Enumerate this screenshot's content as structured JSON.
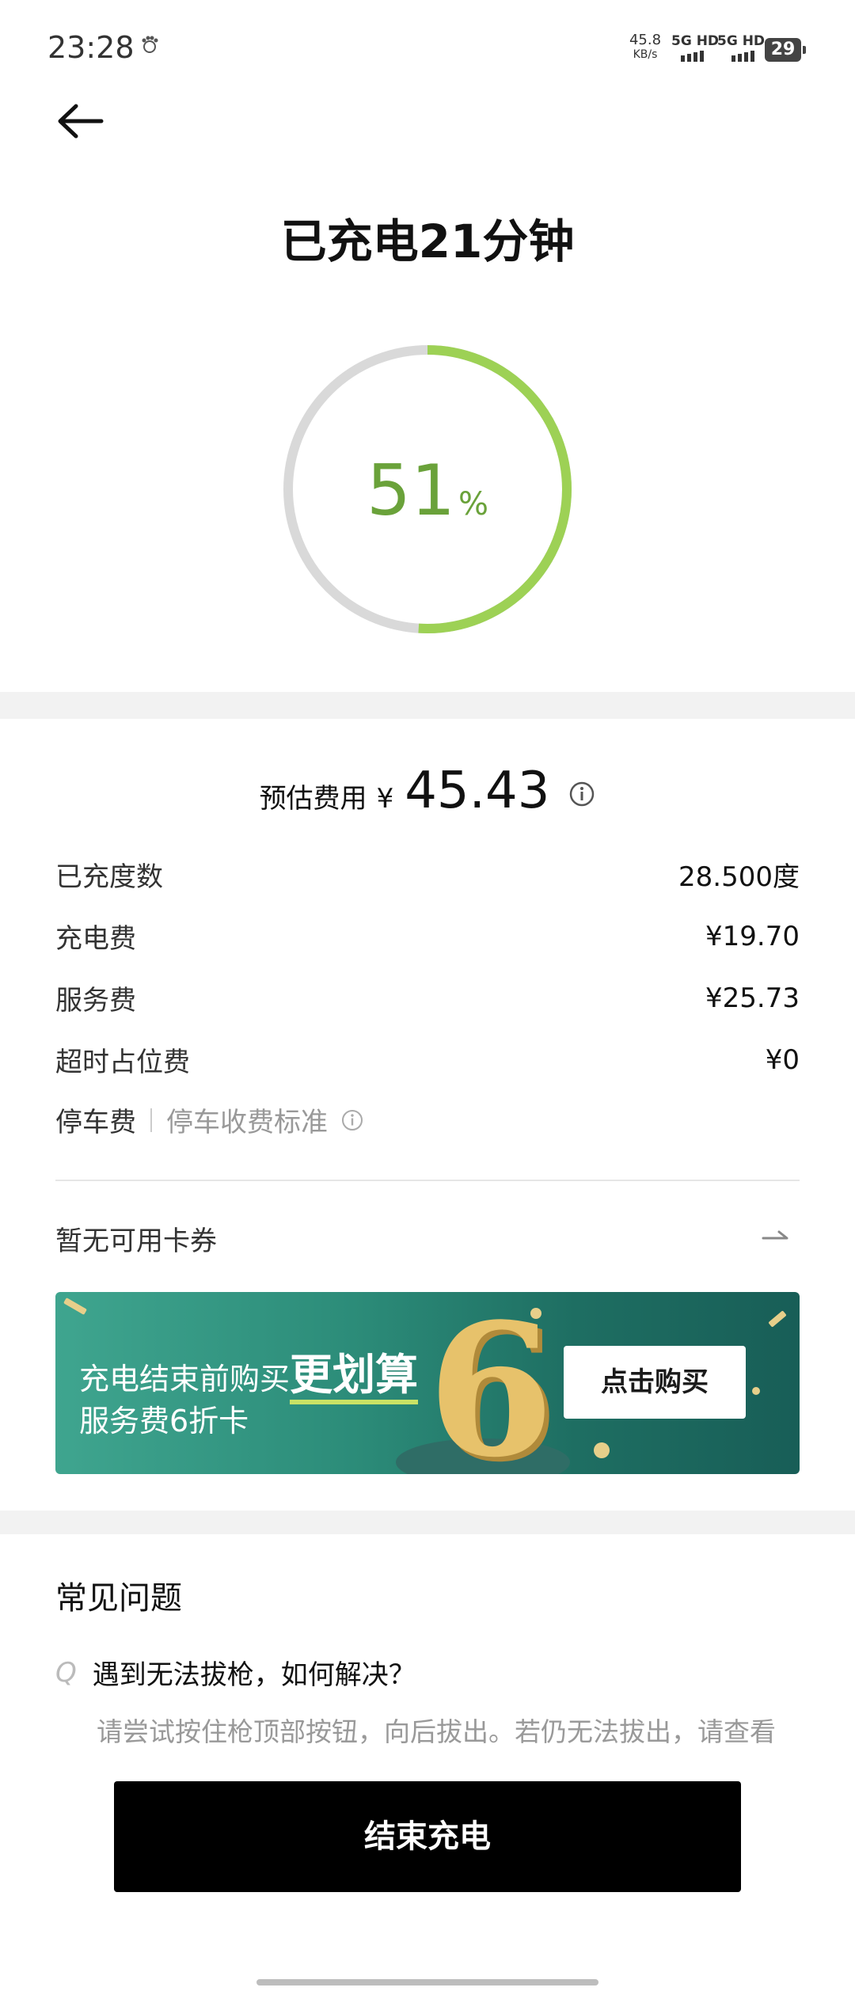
{
  "status_bar": {
    "time": "23:28",
    "net_speed_value": "45.8",
    "net_speed_unit": "KB/s",
    "sim1": "5G HD",
    "sim2": "5G HD",
    "battery": "29",
    "notification_icon": "paw-icon"
  },
  "header": {
    "back_icon": "arrow-left-icon",
    "title": "已充电21分钟"
  },
  "progress": {
    "percent_value": "51",
    "percent_unit": "%",
    "fraction": 0.51,
    "ring_color": "#9dd155",
    "track_color": "#d9d9d9",
    "text_color": "#6aa23a"
  },
  "estimate": {
    "label": "预估费用",
    "currency": "¥",
    "amount": "45.43",
    "info_icon": "info-icon"
  },
  "fees": [
    {
      "label": "已充度数",
      "value": "28.500度"
    },
    {
      "label": "充电费",
      "value": "¥19.70"
    },
    {
      "label": "服务费",
      "value": "¥25.73"
    },
    {
      "label": "超时占位费",
      "value": "¥0"
    }
  ],
  "parking": {
    "label": "停车费",
    "standard_link": "停车收费标准"
  },
  "coupon": {
    "text": "暂无可用卡券",
    "arrow_icon": "arrow-right-icon"
  },
  "banner": {
    "line1_prefix": "充电结束前购买",
    "line1_highlight": "更划算",
    "line2": "服务费6折卡",
    "big_number": "6",
    "button": "点击购买"
  },
  "faq": {
    "title": "常见问题",
    "q_marker": "Q",
    "question": "遇到无法拔枪，如何解决？",
    "answer": "请尝试按住枪顶部按钮，向后拔出。若仍无法拔出，请查看"
  },
  "end_button": "结束充电"
}
